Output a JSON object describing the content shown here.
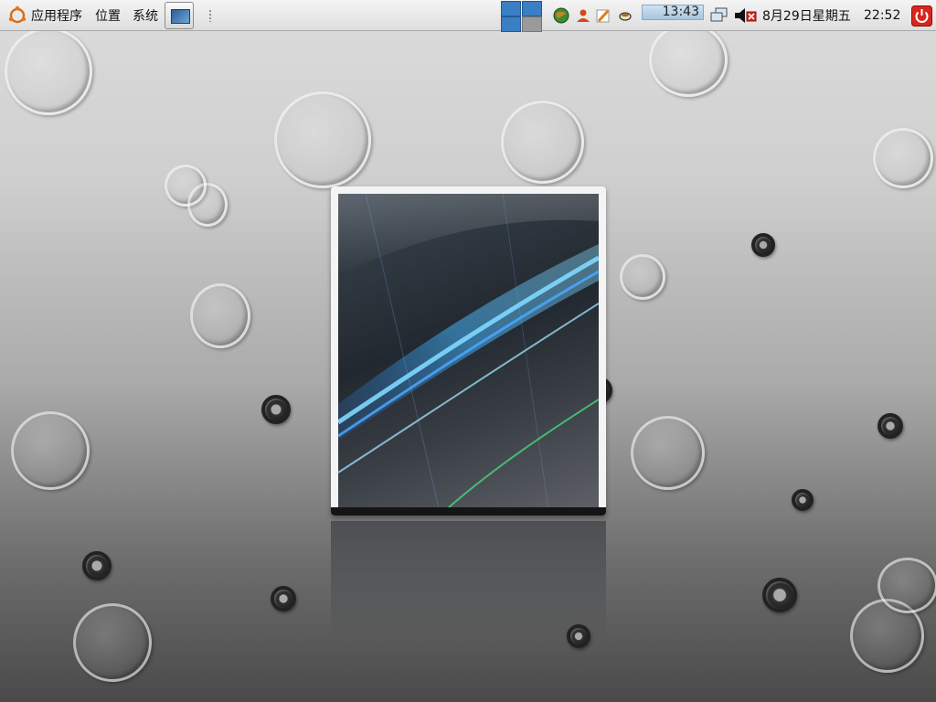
{
  "top_panel": {
    "menus": [
      "应用程序",
      "位置",
      "系统"
    ],
    "clock_time": "13:43",
    "date": "8月29日星期五",
    "time": "22:52"
  },
  "icons": {
    "main_menu": "ubuntu-logo-icon",
    "launcher": "show-desktop-icon",
    "tray": [
      "network-globe-icon",
      "user-icon",
      "edit-pencil-icon",
      "tea-cup-icon"
    ],
    "network_status": "network-status-icon",
    "volume": "volume-muted-icon",
    "shutdown": "power-icon"
  },
  "colors": {
    "panel": "#e6e6e6",
    "workspace_active": "#3a7ec4",
    "shutdown_red": "#d8261e"
  }
}
